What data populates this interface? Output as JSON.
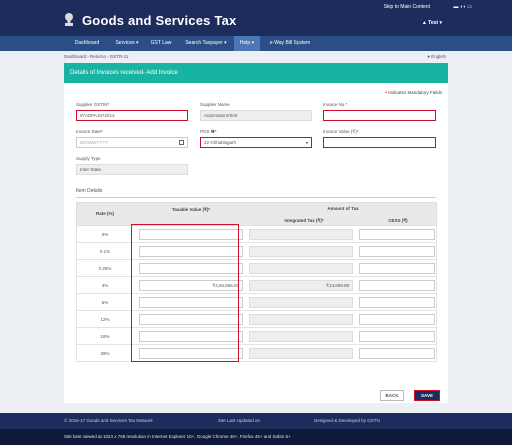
{
  "header": {
    "title": "Goods and Services Tax",
    "skip_link": "Skip to Main Content",
    "user": "▲ Test ▾"
  },
  "nav": {
    "items": [
      {
        "label": "Dashboard"
      },
      {
        "label": "Services ▾"
      },
      {
        "label": "GST Law"
      },
      {
        "label": "Search Taxpayer ▾"
      },
      {
        "label": "Help ▾"
      },
      {
        "label": "e-Way Bill System"
      }
    ]
  },
  "breadcrumb": "Dashboard › Returns › GSTR-11",
  "language": "● English",
  "panel": {
    "title": "Details of Invoices received- Add Invoice",
    "mandatory_note": "Indicates Mandatory Fields"
  },
  "form": {
    "supplier_gstin": {
      "label": "Supplier GSTIN",
      "value": "07ADPA1572013"
    },
    "supplier_name": {
      "label": "Supplier Name",
      "value": "AutomationsTest"
    },
    "invoice_no": {
      "label": "Invoice No.",
      "value": ""
    },
    "invoice_date": {
      "label": "Invoice Date",
      "placeholder": "DD/MM/YYYY"
    },
    "pos": {
      "label": "POS",
      "value": "22-Chhattisgarh"
    },
    "invoice_value": {
      "label": "Invoice Value (₹)",
      "value": ""
    },
    "supply_type": {
      "label": "Supply Type",
      "value": "Inter-State"
    }
  },
  "items": {
    "section_title": "Item Details",
    "headers": {
      "rate": "Rate (%)",
      "taxable": "Taxable Value (₹)",
      "amount_of_tax": "Amount of Tax",
      "integrated": "Integrated Tax (₹)",
      "cess": "CESS (₹)"
    },
    "rows": [
      {
        "rate": "0%",
        "taxable": "",
        "integrated": "",
        "cess": ""
      },
      {
        "rate": "0.1%",
        "taxable": "",
        "integrated": "",
        "cess": ""
      },
      {
        "rate": "0.25%",
        "taxable": "",
        "integrated": "",
        "cess": ""
      },
      {
        "rate": "3%",
        "taxable": "₹4,56,666.00",
        "integrated": "₹13,699.98",
        "cess": ""
      },
      {
        "rate": "5%",
        "taxable": "",
        "integrated": "",
        "cess": ""
      },
      {
        "rate": "12%",
        "taxable": "",
        "integrated": "",
        "cess": ""
      },
      {
        "rate": "18%",
        "taxable": "",
        "integrated": "",
        "cess": ""
      },
      {
        "rate": "28%",
        "taxable": "",
        "integrated": "",
        "cess": ""
      }
    ]
  },
  "buttons": {
    "back": "BACK",
    "save": "SAVE"
  },
  "footer": {
    "copyright": "© 2016-17 Goods and Services Tax Network",
    "updated": "Site Last Updated on",
    "designed": "Designed & Developed by GSTN",
    "browser_note": "Site best viewed at 1024 x 768 resolution in Internet Explorer 10+, Google Chrome 49+, Firefox 45+ and Safari 6+"
  },
  "colors": {
    "header_bg": "#1c2c5c",
    "nav_bg": "#2c4e86",
    "panel_header": "#17b3a3",
    "highlight": "#d0102a"
  }
}
